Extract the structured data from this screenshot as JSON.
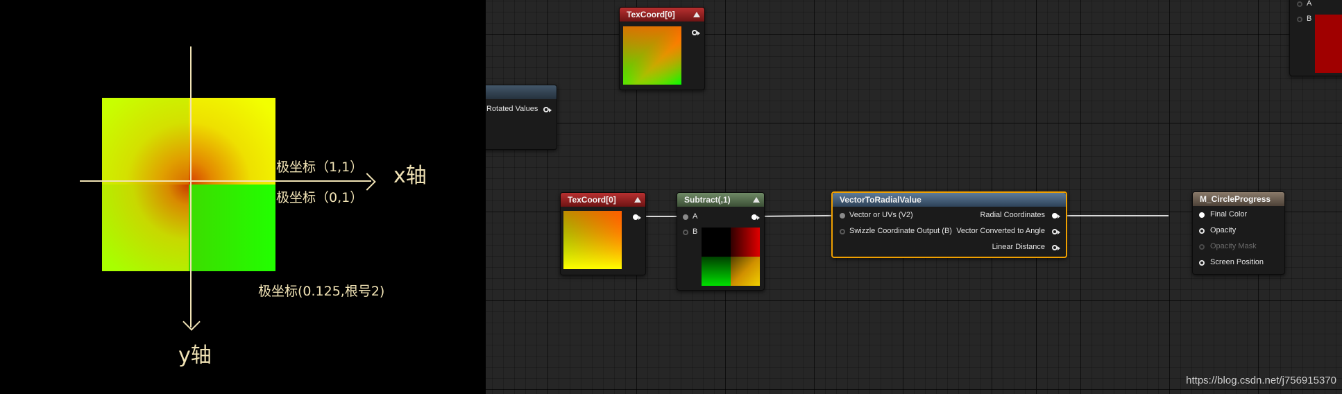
{
  "diagram": {
    "polar_label_11": "极坐标（1,1）",
    "polar_label_01": "极坐标（0,1）",
    "polar_label_bottom": "极坐标(0.125,根号2)",
    "x_axis_label": "x轴",
    "y_axis_label": "y轴"
  },
  "nodes": {
    "texcoord_top": {
      "title": "TexCoord[0]"
    },
    "rotated_values": {
      "output_label": "Rotated Values"
    },
    "texcoord_main": {
      "title": "TexCoord[0]"
    },
    "subtract": {
      "title": "Subtract(,1)",
      "input_a": "A",
      "input_b": "B"
    },
    "vector_to_radial": {
      "title": "VectorToRadialValue",
      "input_1": "Vector or UVs (V2)",
      "input_2": "Swizzle Coordinate Output (B)",
      "output_1": "Radial Coordinates",
      "output_2": "Vector Converted to Angle",
      "output_3": "Linear Distance"
    },
    "material": {
      "title": "M_CircleProgress",
      "input_1": "Final Color",
      "input_2": "Opacity",
      "input_3": "Opacity Mask",
      "input_4": "Screen Position"
    },
    "corner_node": {
      "input_a": "A",
      "input_b": "B"
    }
  },
  "watermark": "https://blog.csdn.net/j756915370",
  "colors": {
    "selected_outline": "#f0a000",
    "axis": "#f1e3b5"
  }
}
